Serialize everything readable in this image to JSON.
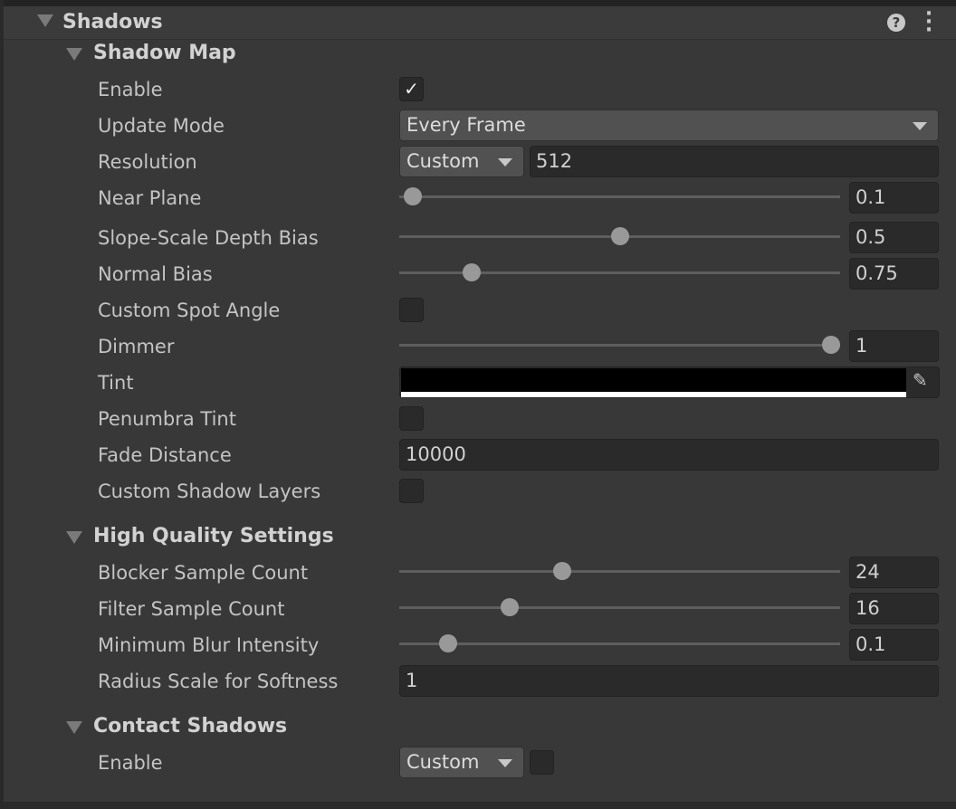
{
  "section": {
    "title": "Shadows",
    "help_icon": "help-icon",
    "menu_icon": "kebab-menu-icon"
  },
  "shadow_map": {
    "title": "Shadow Map",
    "enable": {
      "label": "Enable",
      "checked": true
    },
    "update_mode": {
      "label": "Update Mode",
      "value": "Every Frame"
    },
    "resolution": {
      "label": "Resolution",
      "mode": "Custom",
      "value": "512"
    },
    "near_plane": {
      "label": "Near Plane",
      "value": "0.1",
      "slider_fraction": 0.03
    },
    "slope_bias": {
      "label": "Slope-Scale Depth Bias",
      "value": "0.5",
      "slider_fraction": 0.5
    },
    "normal_bias": {
      "label": "Normal Bias",
      "value": "0.75",
      "slider_fraction": 0.165
    },
    "custom_spot_angle": {
      "label": "Custom Spot Angle",
      "checked": false
    },
    "dimmer": {
      "label": "Dimmer",
      "value": "1",
      "slider_fraction": 1.0
    },
    "tint": {
      "label": "Tint",
      "color": "#000000"
    },
    "penumbra_tint": {
      "label": "Penumbra Tint",
      "checked": false
    },
    "fade_distance": {
      "label": "Fade Distance",
      "value": "10000"
    },
    "custom_shadow_layers": {
      "label": "Custom Shadow Layers",
      "checked": false
    }
  },
  "high_quality": {
    "title": "High Quality Settings",
    "blocker": {
      "label": "Blocker Sample Count",
      "value": "24",
      "slider_fraction": 0.37
    },
    "filter": {
      "label": "Filter Sample Count",
      "value": "16",
      "slider_fraction": 0.25
    },
    "min_blur": {
      "label": "Minimum Blur Intensity",
      "value": "0.1",
      "slider_fraction": 0.11
    },
    "radius_scale": {
      "label": "Radius Scale for Softness",
      "value": "1"
    }
  },
  "contact_shadows": {
    "title": "Contact Shadows",
    "enable": {
      "label": "Enable",
      "mode": "Custom",
      "checked": false
    }
  }
}
